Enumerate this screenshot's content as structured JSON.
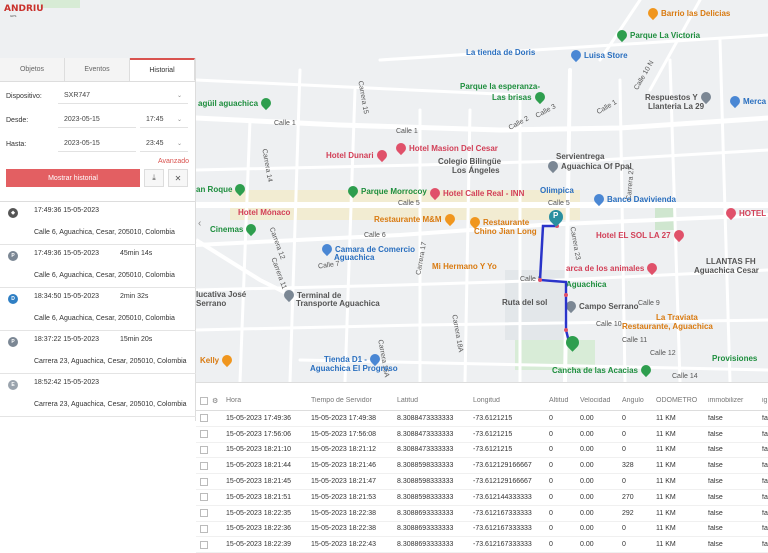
{
  "brand": {
    "name": "ANDRIU",
    "sub": "GPS"
  },
  "tabs": [
    {
      "label": "Objetos"
    },
    {
      "label": "Eventos"
    },
    {
      "label": "Historial"
    }
  ],
  "form": {
    "device_label": "Dispositivo:",
    "device_value": "SXR747",
    "from_label": "Desde:",
    "from_date": "2023-05-15",
    "from_time": "17:45",
    "to_label": "Hasta:",
    "to_date": "2023-05-15",
    "to_time": "23:45",
    "advanced_link": "Avanzado",
    "show_history_button": "Mostrar historial"
  },
  "history": [
    {
      "icon": "stop-icon",
      "time": "17:49:36 15-05-2023",
      "duration": "",
      "address": "Calle 6, Aguachica, Cesar, 205010, Colombia",
      "color": "#555555",
      "glyph": "◆"
    },
    {
      "icon": "parking-icon",
      "time": "17:49:36 15-05-2023",
      "duration": "45min 14s",
      "address": "Calle 6, Aguachica, Cesar, 205010, Colombia",
      "color": "#7b8794",
      "glyph": "P"
    },
    {
      "icon": "drive-icon",
      "time": "18:34:50 15-05-2023",
      "duration": "2min 32s",
      "address": "Calle 6, Aguachica, Cesar, 205010, Colombia",
      "color": "#2f7fc4",
      "glyph": "D"
    },
    {
      "icon": "parking-icon",
      "time": "18:37:22 15-05-2023",
      "duration": "15min 20s",
      "address": "Carrera 23, Aguachica, Cesar, 205010, Colombia",
      "color": "#7b8794",
      "glyph": "P"
    },
    {
      "icon": "event-icon",
      "time": "18:52:42 15-05-2023",
      "duration": "",
      "address": "Carrera 23, Aguachica, Cesar, 205010, Colombia",
      "color": "#9aa3ad",
      "glyph": "E"
    }
  ],
  "table": {
    "headers": [
      "Hora",
      "Tiempo de Servidor",
      "Latitud",
      "Longitud",
      "Altitud",
      "Velocidad",
      "Ángulo",
      "ODOMETRO",
      "immobilizer",
      "ig"
    ],
    "rows": [
      [
        "15-05-2023 17:49:36",
        "15-05-2023 17:49:38",
        "8.3088473333333",
        "-73.6121215",
        "0",
        "0.00",
        "0",
        "11 KM",
        "false",
        "fal"
      ],
      [
        "15-05-2023 17:56:06",
        "15-05-2023 17:56:08",
        "8.3088473333333",
        "-73.6121215",
        "0",
        "0.00",
        "0",
        "11 KM",
        "false",
        "fal"
      ],
      [
        "15-05-2023 18:21:10",
        "15-05-2023 18:21:12",
        "8.3088473333333",
        "-73.6121215",
        "0",
        "0.00",
        "0",
        "11 KM",
        "false",
        "fal"
      ],
      [
        "15-05-2023 18:21:44",
        "15-05-2023 18:21:46",
        "8.3088598333333",
        "-73.612129166667",
        "0",
        "0.00",
        "328",
        "11 KM",
        "false",
        "fal"
      ],
      [
        "15-05-2023 18:21:45",
        "15-05-2023 18:21:47",
        "8.3088598333333",
        "-73.612129166667",
        "0",
        "0.00",
        "0",
        "11 KM",
        "false",
        "fal"
      ],
      [
        "15-05-2023 18:21:51",
        "15-05-2023 18:21:53",
        "8.3088598333333",
        "-73.612144333333",
        "0",
        "0.00",
        "270",
        "11 KM",
        "false",
        "fal"
      ],
      [
        "15-05-2023 18:22:35",
        "15-05-2023 18:22:38",
        "8.3088693333333",
        "-73.612167333333",
        "0",
        "0.00",
        "292",
        "11 KM",
        "false",
        "fal"
      ],
      [
        "15-05-2023 18:22:36",
        "15-05-2023 18:22:38",
        "8.3088693333333",
        "-73.612167333333",
        "0",
        "0.00",
        "0",
        "11 KM",
        "false",
        "fal"
      ],
      [
        "15-05-2023 18:22:39",
        "15-05-2023 18:22:43",
        "8.3088693333333",
        "-73.612167333333",
        "0",
        "0.00",
        "0",
        "11 KM",
        "false",
        "fal"
      ]
    ]
  },
  "map": {
    "streets": [
      {
        "text": "Calle 1"
      },
      {
        "text": "Calle 1"
      },
      {
        "text": "Calle 1"
      },
      {
        "text": "Calle 2"
      },
      {
        "text": "Calle 3"
      },
      {
        "text": "Calle 5"
      },
      {
        "text": "Calle 5"
      },
      {
        "text": "Calle 6"
      },
      {
        "text": "Calle 7"
      },
      {
        "text": "Calle 8"
      },
      {
        "text": "Calle 9"
      },
      {
        "text": "Calle 10"
      },
      {
        "text": "Calle 11"
      },
      {
        "text": "Calle 12"
      },
      {
        "text": "Calle 14"
      },
      {
        "text": "Carrera 15"
      },
      {
        "text": "Carrera 14"
      },
      {
        "text": "Carrera 12"
      },
      {
        "text": "Carrera 11"
      },
      {
        "text": "Carrera 17"
      },
      {
        "text": "Carrera 23"
      },
      {
        "text": "Carrera 27"
      },
      {
        "text": "Carrera 18A"
      },
      {
        "text": "Carrera 15A"
      },
      {
        "text": "Calle 10 N"
      }
    ],
    "pois": [
      {
        "text": "Barrio las Delicias",
        "kind": "orange"
      },
      {
        "text": "Parque La Victoria",
        "kind": "green"
      },
      {
        "text": "La tienda de Doris",
        "kind": "blue"
      },
      {
        "text": "Luisa Store",
        "kind": "blue"
      },
      {
        "text": "Parque la esperanza-",
        "kind": "green"
      },
      {
        "text": "Las brisas",
        "kind": "green"
      },
      {
        "text": "Respuestos Y",
        "kind": "gray"
      },
      {
        "text": "Llanteria La 29",
        "kind": "gray"
      },
      {
        "text": "Merca",
        "kind": "blue"
      },
      {
        "text": "agüil aguachica",
        "kind": "green"
      },
      {
        "text": "Hotel Dunari",
        "kind": "red"
      },
      {
        "text": "Hotel Masion Del Cesar",
        "kind": "red"
      },
      {
        "text": "Colegio Bilingüe",
        "kind": "gray"
      },
      {
        "text": "Los Ángeles",
        "kind": "gray"
      },
      {
        "text": "Servientrega",
        "kind": "gray"
      },
      {
        "text": "Aguachica Of Ppal",
        "kind": "gray"
      },
      {
        "text": "an Roque",
        "kind": "green"
      },
      {
        "text": "Parque Morrocoy",
        "kind": "green"
      },
      {
        "text": "Hotel Calle Real - INN",
        "kind": "red"
      },
      {
        "text": "Olimpica",
        "kind": "blue"
      },
      {
        "text": "Banco Davivienda",
        "kind": "blue"
      },
      {
        "text": "Hotel Mónaco",
        "kind": "red"
      },
      {
        "text": "Restaurante M&M",
        "kind": "orange"
      },
      {
        "text": "Restaurante",
        "kind": "orange"
      },
      {
        "text": "Chino Jian Long",
        "kind": "orange"
      },
      {
        "text": "HOTEL E",
        "kind": "red"
      },
      {
        "text": "Cinemas",
        "kind": "green"
      },
      {
        "text": "Hotel EL SOL LA 27",
        "kind": "red"
      },
      {
        "text": "Camara de Comercio",
        "kind": "blue"
      },
      {
        "text": "Aguachica",
        "kind": "blue"
      },
      {
        "text": "Mi Hermano Y Yo",
        "kind": "orange"
      },
      {
        "text": "arca de los animales",
        "kind": "red"
      },
      {
        "text": "LLANTAS FH",
        "kind": "gray"
      },
      {
        "text": "Aguachica Cesar",
        "kind": "gray"
      },
      {
        "text": "Aguachica",
        "kind": "green"
      },
      {
        "text": "Ruta del sol",
        "kind": "gray"
      },
      {
        "text": "Campo Serrano",
        "kind": "gray"
      },
      {
        "text": "Terminal de",
        "kind": "gray"
      },
      {
        "text": "Transporte Aguachica",
        "kind": "gray"
      },
      {
        "text": "La Traviata",
        "kind": "orange"
      },
      {
        "text": "Restaurante, Aguachica",
        "kind": "orange"
      },
      {
        "text": "lucativa José",
        "kind": "gray"
      },
      {
        "text": "Serrano",
        "kind": "gray"
      },
      {
        "text": "Provisiones",
        "kind": "green"
      },
      {
        "text": "Kelly",
        "kind": "orange"
      },
      {
        "text": "Tienda D1 -",
        "kind": "blue"
      },
      {
        "text": "Aguachica El Progreso",
        "kind": "blue"
      },
      {
        "text": "Cancha de las Acacias",
        "kind": "green"
      }
    ],
    "route_color": "#2a34c9",
    "start_marker_label": "P"
  }
}
